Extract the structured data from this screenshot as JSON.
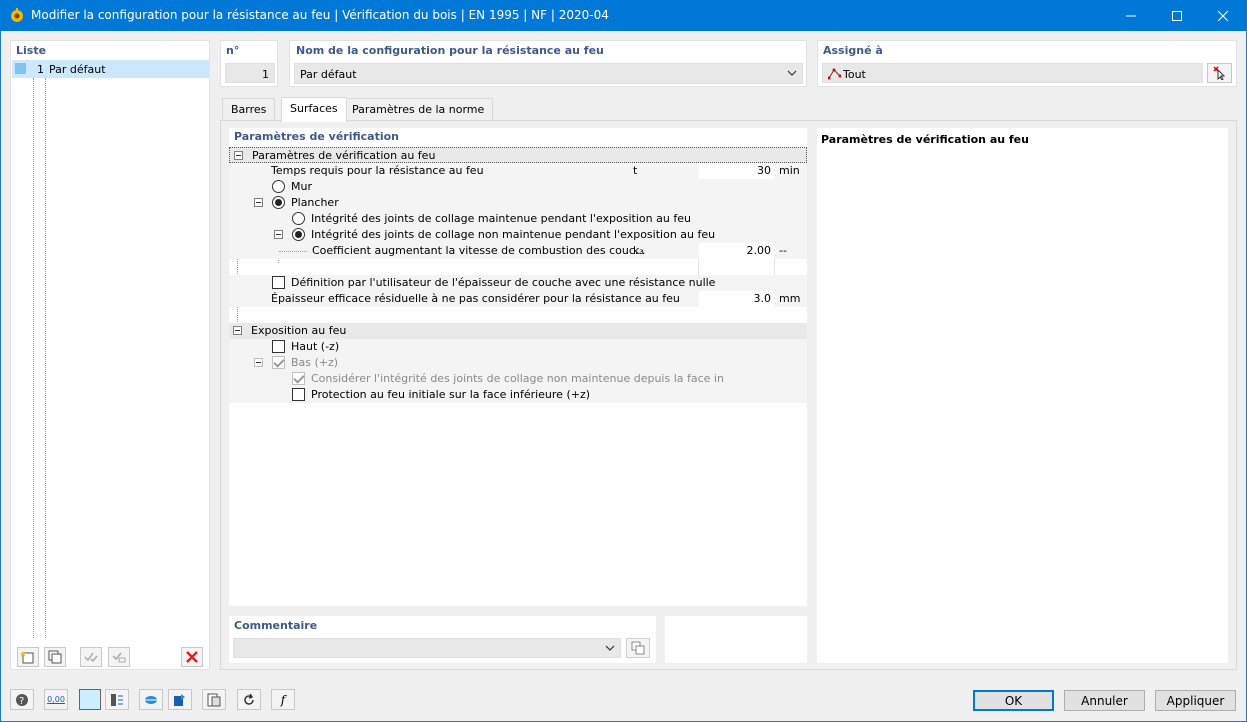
{
  "window": {
    "title": "Modifier la configuration pour la résistance au feu | Vérification du bois | EN 1995 | NF | 2020-04"
  },
  "list": {
    "header": "Liste",
    "items": [
      {
        "num": "1",
        "label": "Par défaut"
      }
    ]
  },
  "number": {
    "header": "n°",
    "value": "1"
  },
  "config_name": {
    "header": "Nom de la configuration pour la résistance au feu",
    "value": "Par défaut"
  },
  "assigned": {
    "header": "Assigné à",
    "value": "Tout"
  },
  "tabs": [
    {
      "label": "Barres"
    },
    {
      "label": "Surfaces"
    },
    {
      "label": "Paramètres de la norme"
    }
  ],
  "params": {
    "header": "Paramètres de vérification",
    "group1": {
      "label": "Paramètres de vérification au feu",
      "required_time": {
        "label": "Temps requis pour la résistance au feu",
        "symbol": "t",
        "value": "30",
        "unit": "min"
      },
      "mur": "Mur",
      "plancher": "Plancher",
      "integrity_kept": "Intégrité des joints de collage maintenue pendant l'exposition au feu",
      "integrity_not_kept": "Intégrité des joints de collage non maintenue pendant l'exposition au feu",
      "coef": {
        "label": "Coefficient augmentant la vitesse de combustion des couc...",
        "symbol": "k₃",
        "value": "2.00",
        "unit": "--"
      },
      "user_def": "Définition par l'utilisateur de l'épaisseur de couche avec une résistance nulle",
      "residual": {
        "label": "Épaisseur efficace résiduelle à ne pas considérer pour la résistance au feu",
        "value": "3.0",
        "unit": "mm"
      }
    },
    "group2": {
      "label": "Exposition au feu",
      "haut": "Haut (-z)",
      "bas": "Bas (+z)",
      "consider": "Considérer l'intégrité des joints de collage non maintenue depuis la face in",
      "protection": "Protection au feu initiale sur la face inférieure (+z)"
    }
  },
  "info_panel": {
    "header": "Paramètres de vérification au feu"
  },
  "comment": {
    "header": "Commentaire",
    "value": ""
  },
  "buttons": {
    "ok": "OK",
    "cancel": "Annuler",
    "apply": "Appliquer"
  },
  "bottom_value_icon": "0,00",
  "colors": {
    "titlebar": "#0078d7",
    "header_text": "#3d5a8a",
    "selection": "#cce8ff",
    "delete": "#e02020"
  }
}
